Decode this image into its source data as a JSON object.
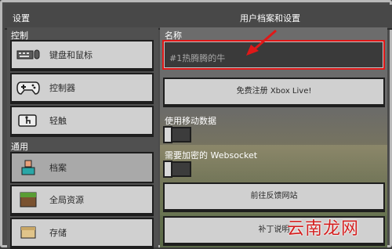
{
  "window": {
    "title_left": "设置",
    "title_right": "用户档案和设置"
  },
  "sidebar": {
    "section_control": "控制",
    "section_general": "通用",
    "items": [
      {
        "label": "键盘和鼠标",
        "icon": "keyboard-mouse-icon"
      },
      {
        "label": "控制器",
        "icon": "controller-icon"
      },
      {
        "label": "轻触",
        "icon": "touch-icon"
      },
      {
        "label": "档案",
        "icon": "profile-icon"
      },
      {
        "label": "全局资源",
        "icon": "global-resources-icon"
      },
      {
        "label": "存储",
        "icon": "storage-icon"
      }
    ]
  },
  "profile": {
    "name_label": "名称",
    "name_value": "#1热腾腾的牛",
    "xbox_button": "免费注册 Xbox Live!",
    "mobile_data_label": "使用移动数据",
    "websocket_label": "需要加密的 Websocket",
    "feedback_button": "前往反馈网站",
    "patch_button": "补丁说明"
  },
  "watermark": "云南龙网",
  "colors": {
    "annotation_red": "#e01818"
  }
}
